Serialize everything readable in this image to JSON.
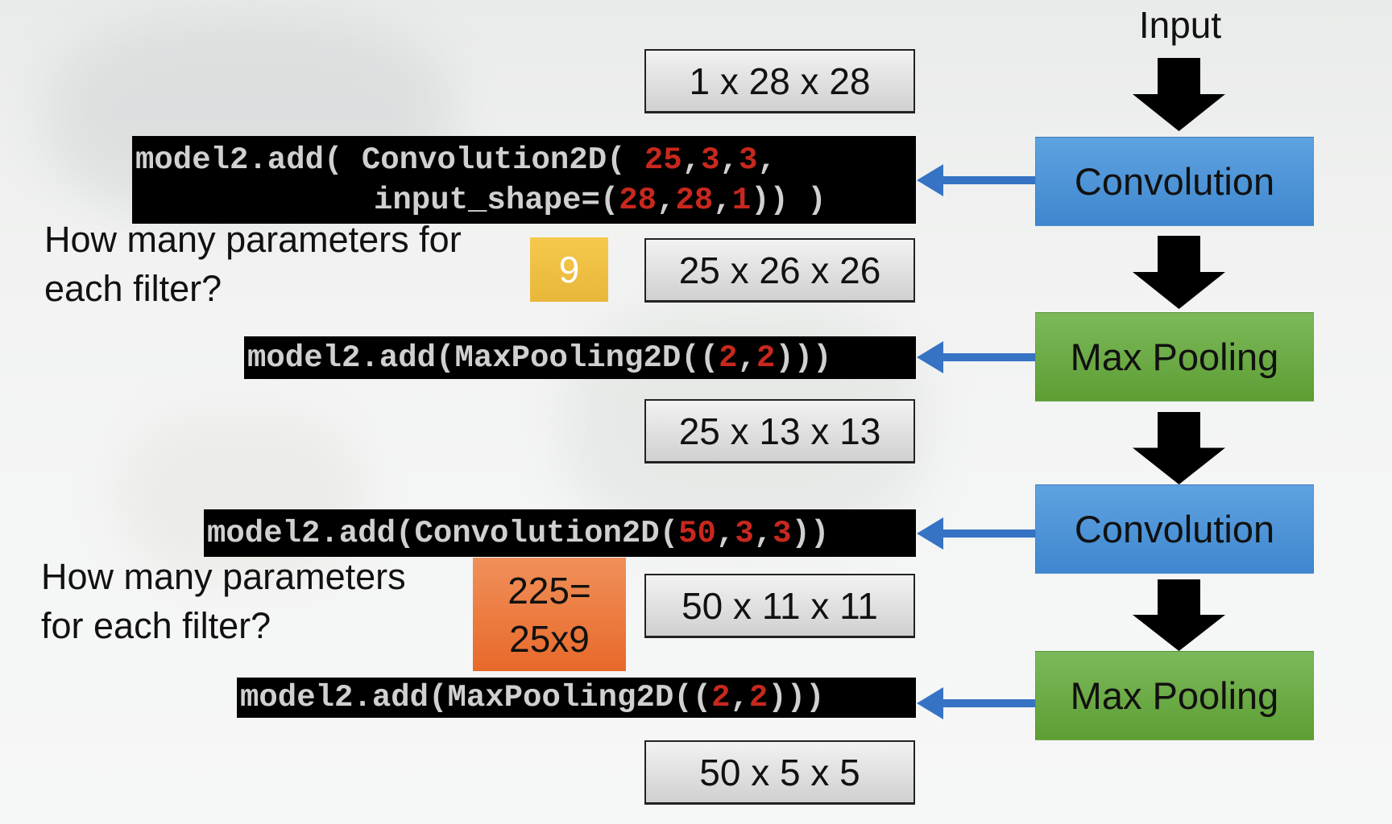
{
  "input_label": "Input",
  "flow": [
    {
      "label": "Convolution",
      "color": "#4a90d9"
    },
    {
      "label": "Max Pooling",
      "color": "#6aab44"
    },
    {
      "label": "Convolution",
      "color": "#4a90d9"
    },
    {
      "label": "Max Pooling",
      "color": "#6aab44"
    }
  ],
  "shapes": [
    "1 x 28 x 28",
    "25 x 26 x 26",
    "25 x 13 x 13",
    "50 x 11 x 11",
    "50 x 5 x 5"
  ],
  "code": {
    "conv1": {
      "line1_a": "model2.add( Convolution2D( ",
      "line1_n1": "25",
      "c1": ",",
      "line1_n2": "3",
      "c2": ",",
      "line1_n3": "3",
      "line1_end": ",",
      "line2_a": "input_shape=(",
      "line2_n1": "28",
      "c3": ",",
      "line2_n2": "28",
      "c4": ",",
      "line2_n3": "1",
      "line2_end": ")) )"
    },
    "pool1": {
      "a": "model2.add(MaxPooling2D((",
      "n1": "2",
      "c": ",",
      "n2": "2",
      "end": ")))"
    },
    "conv2": {
      "a": "model2.add(Convolution2D(",
      "n1": "50",
      "c1": ",",
      "n2": "3",
      "c2": ",",
      "n3": "3",
      "end": "))"
    },
    "pool2": {
      "a": "model2.add(MaxPooling2D((",
      "n1": "2",
      "c": ",",
      "n2": "2",
      "end": ")))"
    }
  },
  "questions": [
    {
      "line1": "How many parameters for",
      "line2": "each filter?",
      "answer": "9",
      "answer_color": "#efc03e"
    },
    {
      "line1": "How many parameters",
      "line2": "for each filter?",
      "answer_line1": "225=",
      "answer_line2": "25x9",
      "answer_color": "#ec7a35"
    }
  ],
  "colors": {
    "arrow_blue": "#3673c4",
    "code_number_red": "#c8281e"
  }
}
